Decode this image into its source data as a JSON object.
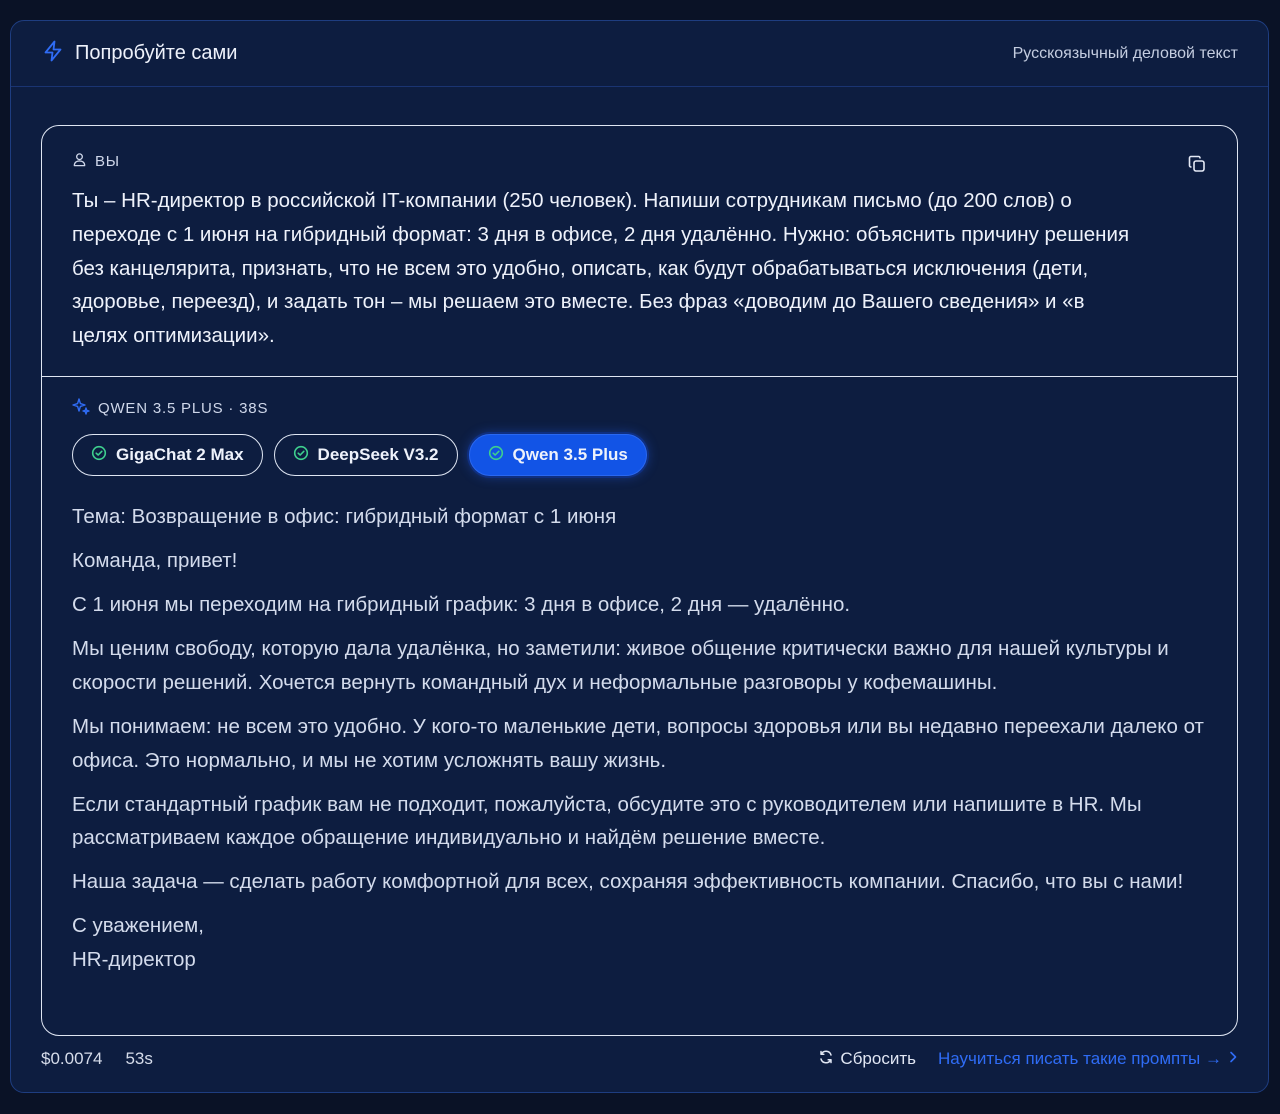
{
  "header": {
    "title": "Попробуйте сами",
    "subtitle": "Русскоязычный деловой текст"
  },
  "user": {
    "role_label": "ВЫ",
    "prompt": "Ты – HR-директор в российской IT-компании (250 человек). Напиши сотрудникам письмо (до 200 слов) о переходе с 1 июня на гибридный формат: 3 дня в офисе, 2 дня удалённо. Нужно: объяснить причину решения без канцелярита, признать, что не всем это удобно, описать, как будут обрабатываться исключения (дети, здоровье, переезд), и задать тон – мы решаем это вместе. Без фраз «доводим до Вашего сведения» и «в целях оптимизации»."
  },
  "assistant": {
    "model_label": "QWEN 3.5 PLUS · 38S"
  },
  "tabs": [
    {
      "label": "GigaChat 2 Max",
      "active": false
    },
    {
      "label": "DeepSeek V3.2",
      "active": false
    },
    {
      "label": "Qwen 3.5 Plus",
      "active": true
    }
  ],
  "response": {
    "paragraphs": [
      "Тема: Возвращение в офис: гибридный формат с 1 июня",
      "Команда, привет!",
      "С 1 июня мы переходим на гибридный график: 3 дня в офисе, 2 дня — удалённо.",
      "Мы ценим свободу, которую дала удалёнка, но заметили: живое общение критически важно для нашей культуры и скорости решений. Хочется вернуть командный дух и неформальные разговоры у кофемашины.",
      "Мы понимаем: не всем это удобно. У кого-то маленькие дети, вопросы здоровья или вы недавно переехали далеко от офиса. Это нормально, и мы не хотим усложнять вашу жизнь.",
      "Если стандартный график вам не подходит, пожалуйста, обсудите это с руководителем или напишите в HR. Мы рассматриваем каждое обращение индивидуально и найдём решение вместе.",
      "Наша задача — сделать работу комфортной для всех, сохраняя эффективность компании. Спасибо, что вы с нами!"
    ],
    "closing_line1": "С уважением,",
    "closing_line2": "HR-директор"
  },
  "footer": {
    "cost": "$0.0074",
    "time": "53s",
    "reset_label": "Сбросить",
    "learn_label": "Научиться писать такие промпты →"
  },
  "colors": {
    "background": "#0a1226",
    "panel": "#0d1d40",
    "accent": "#1254e6",
    "link": "#2f6cf5",
    "check_green": "#3ecf8e"
  },
  "icons": {
    "header": "lightning-icon",
    "user": "user-icon",
    "copy": "copy-icon",
    "model": "sparkles-icon",
    "check": "check-circle-icon",
    "reset": "refresh-icon",
    "chevron": "chevron-right-icon"
  }
}
